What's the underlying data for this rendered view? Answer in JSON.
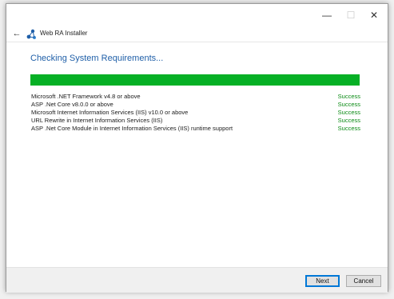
{
  "window": {
    "controls": {
      "minimize": "—",
      "maximize": "☐",
      "close": "✕"
    }
  },
  "nav": {
    "back_icon": "←",
    "app_icon": "web-ra-logo-icon",
    "app_title": "Web RA Installer"
  },
  "main": {
    "heading": "Checking System Requirements...",
    "progress_percent": 100,
    "progress_color": "#06b025",
    "requirements": [
      {
        "name": "Microsoft .NET Framework v4.8 or above",
        "status": "Success"
      },
      {
        "name": "ASP .Net Core v8.0.0 or above",
        "status": "Success"
      },
      {
        "name": "Microsoft Internet Information Services (IIS) v10.0 or above",
        "status": "Success"
      },
      {
        "name": "URL Rewrite in Internet Information Services (IIS)",
        "status": "Success"
      },
      {
        "name": "ASP .Net Core Module in Internet Information Services (IIS) runtime support",
        "status": "Success"
      }
    ]
  },
  "footer": {
    "next_label": "Next",
    "cancel_label": "Cancel"
  },
  "colors": {
    "heading": "#1f5fa8",
    "success": "#0a8a14",
    "focus_border": "#0078d7"
  }
}
